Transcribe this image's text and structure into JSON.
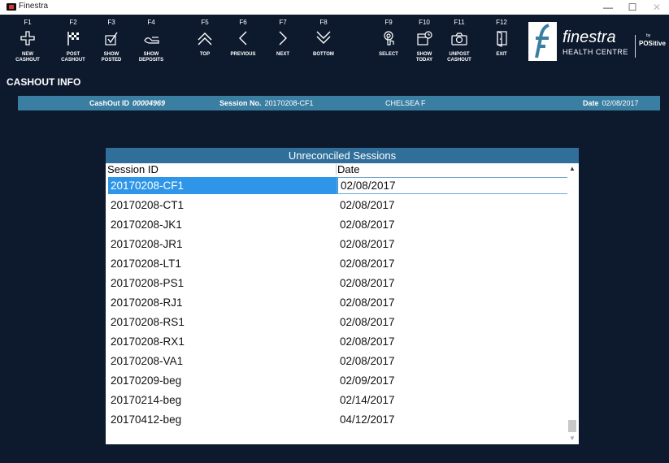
{
  "window": {
    "title": "Finestra",
    "min_glyph": "—",
    "max_glyph": "☐",
    "close_glyph": "✕"
  },
  "toolbar": [
    {
      "key": "F1",
      "label": "NEW\nCASHOUT",
      "icon": "plus-icon"
    },
    {
      "key": "F2",
      "label": "POST\nCASHOUT",
      "icon": "checkered-flag-icon"
    },
    {
      "key": "F3",
      "label": "SHOW POSTED",
      "icon": "checkbox-icon"
    },
    {
      "key": "F4",
      "label": "SHOW\nDEPOSITS",
      "icon": "deposit-icon"
    },
    {
      "key": "F5",
      "label": "TOP",
      "icon": "chevron-double-up-icon"
    },
    {
      "key": "F6",
      "label": "PREVIOUS",
      "icon": "chevron-left-icon"
    },
    {
      "key": "F7",
      "label": "NEXT",
      "icon": "chevron-right-icon"
    },
    {
      "key": "F8",
      "label": "BOTTOM",
      "icon": "chevron-double-down-icon"
    },
    {
      "key": "F9",
      "label": "SELECT",
      "icon": "touch-icon"
    },
    {
      "key": "F10",
      "label": "SHOW\nTODAY",
      "icon": "calendar-icon"
    },
    {
      "key": "F11",
      "label": "UNPOST\nCASHOUT",
      "icon": "camera-icon"
    },
    {
      "key": "F12",
      "label": "EXIT",
      "icon": "door-icon"
    }
  ],
  "logo": {
    "brand": "finestra",
    "subtitle": "HEALTH CENTRE",
    "by": "by",
    "partner": "POSitive"
  },
  "section_title": "CASHOUT INFO",
  "info": {
    "cashout_label": "CashOut ID",
    "cashout_id": "00004969",
    "session_label": "Session No.",
    "session_no": "20170208-CF1",
    "user": "CHELSEA F",
    "date_label": "Date",
    "date": "02/08/2017"
  },
  "dialog": {
    "title": "Unreconciled Sessions",
    "col_session": "Session ID",
    "col_date": "Date",
    "rows": [
      {
        "session": "20170208-CF1",
        "date": "02/08/2017"
      },
      {
        "session": "20170208-CT1",
        "date": "02/08/2017"
      },
      {
        "session": "20170208-JK1",
        "date": "02/08/2017"
      },
      {
        "session": "20170208-JR1",
        "date": "02/08/2017"
      },
      {
        "session": "20170208-LT1",
        "date": "02/08/2017"
      },
      {
        "session": "20170208-PS1",
        "date": "02/08/2017"
      },
      {
        "session": "20170208-RJ1",
        "date": "02/08/2017"
      },
      {
        "session": "20170208-RS1",
        "date": "02/08/2017"
      },
      {
        "session": "20170208-RX1",
        "date": "02/08/2017"
      },
      {
        "session": "20170208-VA1",
        "date": "02/08/2017"
      },
      {
        "session": "20170209-beg",
        "date": "02/09/2017"
      },
      {
        "session": "20170214-beg",
        "date": "02/14/2017"
      },
      {
        "session": "20170412-beg",
        "date": "04/12/2017"
      }
    ],
    "selected_index": 0
  },
  "colors": {
    "background": "#0d1a2e",
    "infobar": "#3a7ea1",
    "dialog_title": "#2f6f9a",
    "selection": "#2e95e8"
  }
}
